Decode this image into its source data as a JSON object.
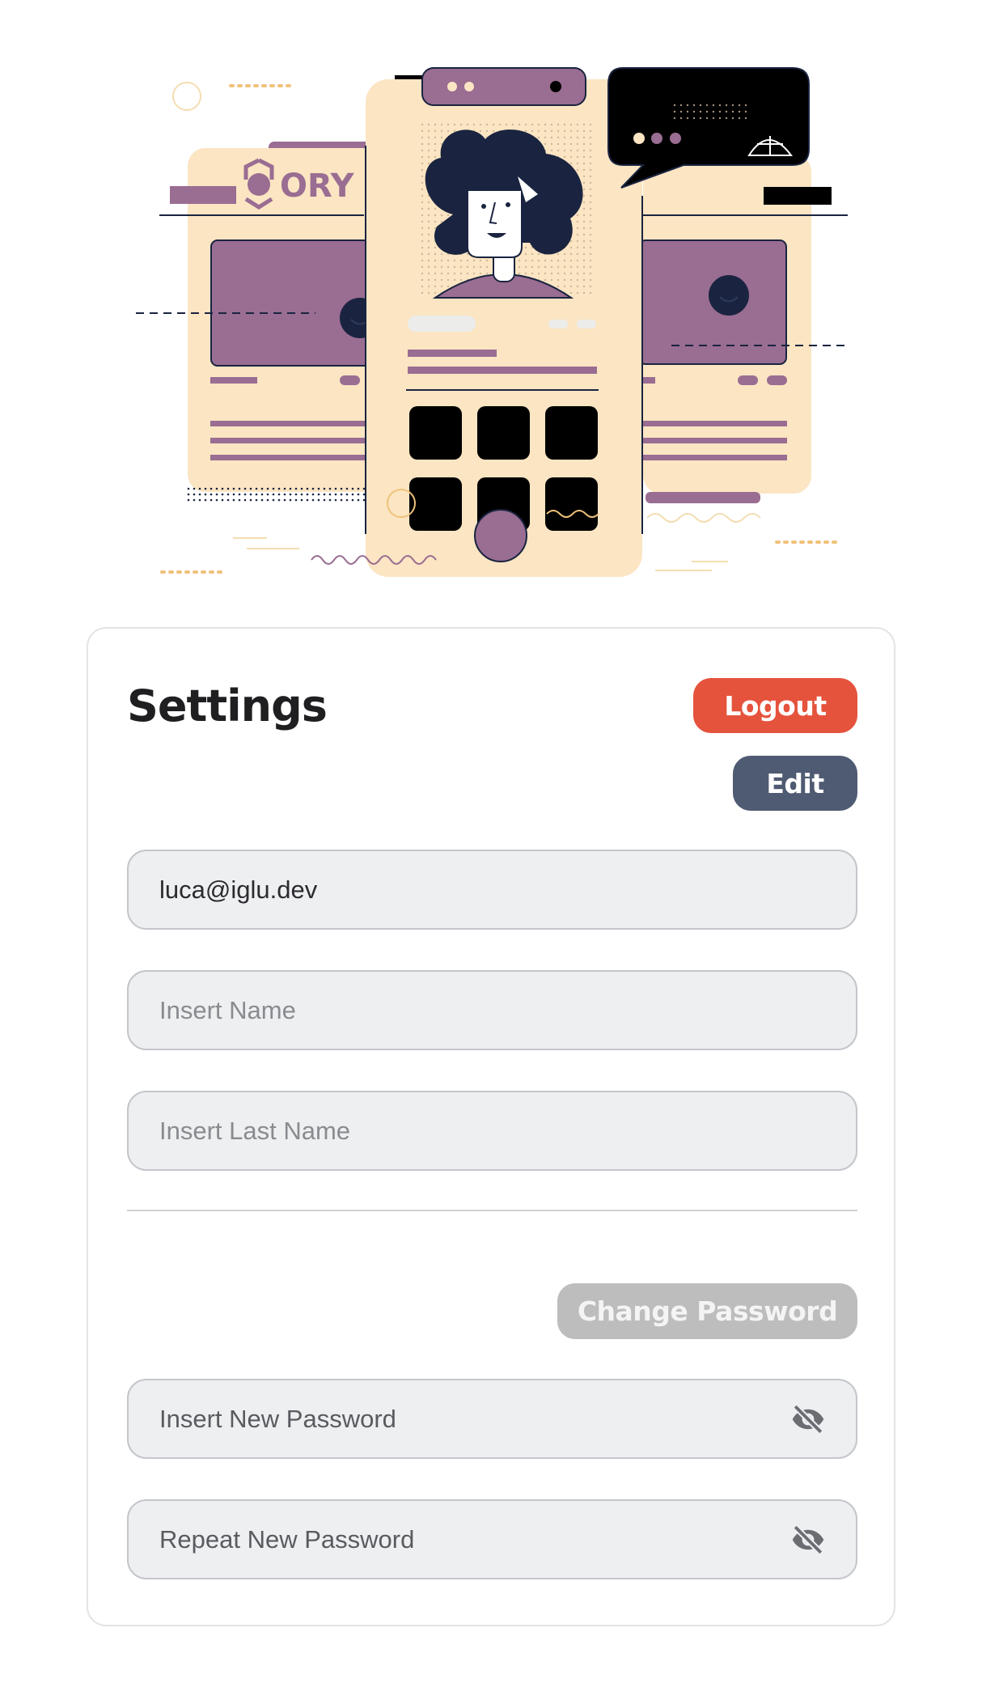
{
  "brand": {
    "logo_text": "ORY"
  },
  "settings": {
    "title": "Settings",
    "logout_label": "Logout",
    "edit_label": "Edit",
    "email_value": "luca@iglu.dev",
    "name_placeholder": "Insert Name",
    "lastname_placeholder": "Insert Last Name",
    "change_password_label": "Change Password",
    "new_password_placeholder": "Insert New Password",
    "repeat_password_placeholder": "Repeat New Password"
  },
  "icons": {
    "password_toggle": "eye-slash-icon"
  },
  "colors": {
    "logout": "#e5533d",
    "edit": "#4f5b72",
    "change_password": "#bdbdbd",
    "illustration_purple": "#9a6d92",
    "illustration_cream": "#fbe5c3",
    "illustration_navy": "#1a2440"
  }
}
